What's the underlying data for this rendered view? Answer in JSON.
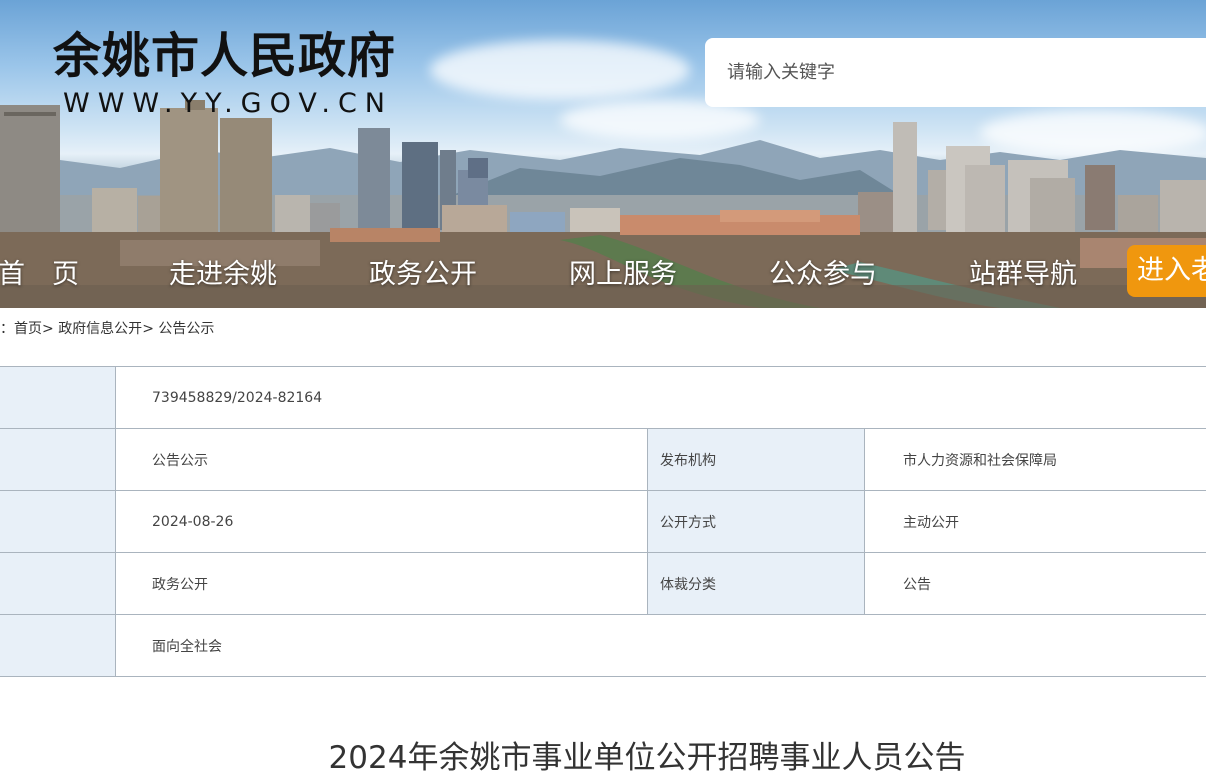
{
  "header": {
    "site_title": "余姚市人民政府",
    "site_url": "WWW.YY.GOV.CN",
    "search_placeholder": "请输入关键字"
  },
  "nav": {
    "items": [
      "首　页",
      "走进余姚",
      "政务公开",
      "网上服务",
      "公众参与",
      "站群导航"
    ],
    "enter_label": "进入老"
  },
  "breadcrumb": {
    "prefix": "置：",
    "items": [
      "首页",
      "政府信息公开",
      "公告公示"
    ],
    "separator": ">"
  },
  "info_table": {
    "index_no": "739458829/2024-82164",
    "rows": [
      {
        "value": "公告公示",
        "label2": "发布机构",
        "value2": "市人力资源和社会保障局"
      },
      {
        "value": "2024-08-26",
        "label2": "公开方式",
        "value2": "主动公开"
      },
      {
        "value": "政务公开",
        "label2": "体裁分类",
        "value2": "公告"
      }
    ],
    "scope": "面向全社会"
  },
  "article": {
    "title": "2024年余姚市事业单位公开招聘事业人员公告"
  },
  "colors": {
    "accent_orange": "#f0970e",
    "label_cell_bg": "#e8f0f8",
    "border": "#aab4be"
  }
}
